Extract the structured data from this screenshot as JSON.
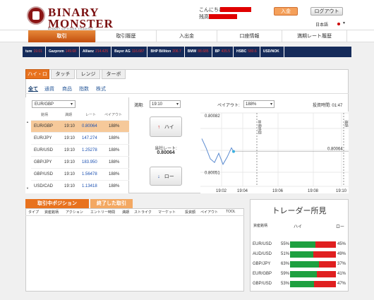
{
  "brand": {
    "line1": "BINARY",
    "line2": "MONSTER",
    "tagline": "BINARY OPTIONS TRADING"
  },
  "header": {
    "greeting": "こんにちは",
    "balance_label": "残高",
    "deposit": "入金",
    "logout": "ログアウト",
    "language": "日本語"
  },
  "nav": [
    "取引",
    "取引履歴",
    "入出金",
    "口座情報",
    "満期レート履歴"
  ],
  "ticker": [
    {
      "name": "ture",
      "value": "19.01"
    },
    {
      "name": "Gazprom",
      "value": "149.68"
    },
    {
      "name": "Allianz",
      "value": "214.425"
    },
    {
      "name": "Bayer AG",
      "value": "116.687"
    },
    {
      "name": "BHP Billiton",
      "value": "206.7"
    },
    {
      "name": "BMW",
      "value": "88.685"
    },
    {
      "name": "BP",
      "value": "435.5"
    },
    {
      "name": "HSBC",
      "value": "580.6"
    },
    {
      "name": "USD/NOK",
      "value": ""
    }
  ],
  "option_tabs": [
    "ハイ・ロー",
    "タッチ",
    "レンジ",
    "ターボ"
  ],
  "categories": [
    "全て",
    "通貨",
    "商品",
    "指数",
    "株式"
  ],
  "asset_select": "EUR/GBP",
  "asset_table": {
    "headers": [
      "銘柄",
      "満期",
      "レート",
      "ペイアウト"
    ],
    "rows": [
      {
        "asset": "EUR/GBP",
        "expiry": "19:10",
        "rate": "0.80064",
        "payout": "188%"
      },
      {
        "asset": "EUR/JPY",
        "expiry": "19:10",
        "rate": "147.274",
        "payout": "188%"
      },
      {
        "asset": "EUR/USD",
        "expiry": "19:10",
        "rate": "1.25278",
        "payout": "188%"
      },
      {
        "asset": "GBP/JPY",
        "expiry": "19:10",
        "rate": "183.950",
        "payout": "188%"
      },
      {
        "asset": "GBP/USD",
        "expiry": "19:10",
        "rate": "1.56478",
        "payout": "188%"
      },
      {
        "asset": "USD/CAD",
        "expiry": "19:10",
        "rate": "1.13418",
        "payout": "188%"
      }
    ]
  },
  "trade": {
    "expiry_label": "満期:",
    "expiry_value": "19:10",
    "payout_label": "ペイアウト:",
    "payout_value": "188%",
    "time_label": "投資時間: 01:47",
    "high": "ハイ",
    "low": "ロー",
    "rate_label": "当社レート:",
    "rate_value": "0.80064"
  },
  "chart_data": {
    "type": "line",
    "x": [
      "19:01",
      "19:01:30",
      "19:02",
      "19:02:30",
      "19:03",
      "19:03:30",
      "19:04"
    ],
    "values": [
      0.80072,
      0.80061,
      0.80058,
      0.80066,
      0.80057,
      0.80062,
      0.80064
    ],
    "xticks": [
      "19:02",
      "19:04",
      "19:06",
      "19:08",
      "19:10"
    ],
    "ylabels": [
      "0.80082",
      "0.80064",
      "0.80051"
    ],
    "markers": [
      "目標時間",
      "満期"
    ],
    "current_rate": "0.80064"
  },
  "positions": {
    "tab_open": "取引中ポジション",
    "tab_closed": "終了した取引",
    "headers": [
      "タイプ",
      "資産銘柄",
      "アクション",
      "エントリー時間",
      "満期",
      "ストライク",
      "マーケット",
      "投資額",
      "ペイアウト",
      "TOOL"
    ]
  },
  "sentiment": {
    "title": "トレーダー所見",
    "col_asset": "資産銘柄",
    "col_high": "ハイ",
    "col_low": "ロー",
    "rows": [
      {
        "asset": "EUR/USD",
        "high": "55%",
        "low": "45%",
        "high_pct": 55
      },
      {
        "asset": "AUD/USD",
        "high": "51%",
        "low": "49%",
        "high_pct": 51
      },
      {
        "asset": "GBP/JPY",
        "high": "63%",
        "low": "37%",
        "high_pct": 63
      },
      {
        "asset": "EUR/GBP",
        "high": "59%",
        "low": "41%",
        "high_pct": 59
      },
      {
        "asset": "GBP/USD",
        "high": "53%",
        "low": "47%",
        "high_pct": 53
      }
    ]
  },
  "colors": {
    "accent": "#e8721e",
    "navy": "#152b5a",
    "brand": "#7a1010",
    "high_bar": "#1ea040",
    "low_bar": "#e02020"
  }
}
